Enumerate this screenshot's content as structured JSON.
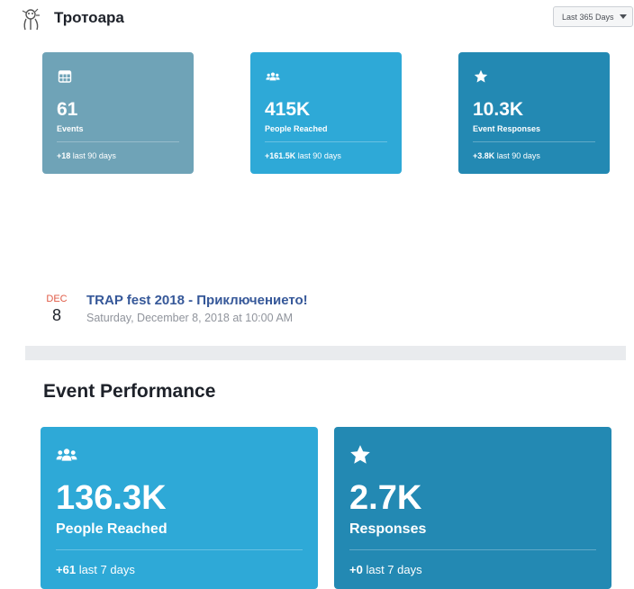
{
  "header": {
    "page_name": "Тротоара",
    "date_range": "Last 365 Days"
  },
  "summary_cards": [
    {
      "icon": "calendar-icon",
      "value": "61",
      "label": "Events",
      "change": "+18",
      "period": "last 90 days",
      "color": "#6fa3b7"
    },
    {
      "icon": "people-icon",
      "value": "415K",
      "label": "People Reached",
      "change": "+161.5K",
      "period": "last 90 days",
      "color": "#2ea9d7"
    },
    {
      "icon": "star-icon",
      "value": "10.3K",
      "label": "Event Responses",
      "change": "+3.8K",
      "period": "last 90 days",
      "color": "#2389b3"
    }
  ],
  "event": {
    "month": "DEC",
    "day": "8",
    "title": "TRAP fest 2018 - Приключението!",
    "datetime": "Saturday, December 8, 2018 at 10:00 AM"
  },
  "performance": {
    "title": "Event Performance",
    "cards": [
      {
        "icon": "people-icon",
        "value": "136.3K",
        "label": "People Reached",
        "change": "+61",
        "period": "last 7 days",
        "color": "#2ea9d7"
      },
      {
        "icon": "star-icon",
        "value": "2.7K",
        "label": "Responses",
        "change": "+0",
        "period": "last 7 days",
        "color": "#2389b3"
      }
    ]
  }
}
